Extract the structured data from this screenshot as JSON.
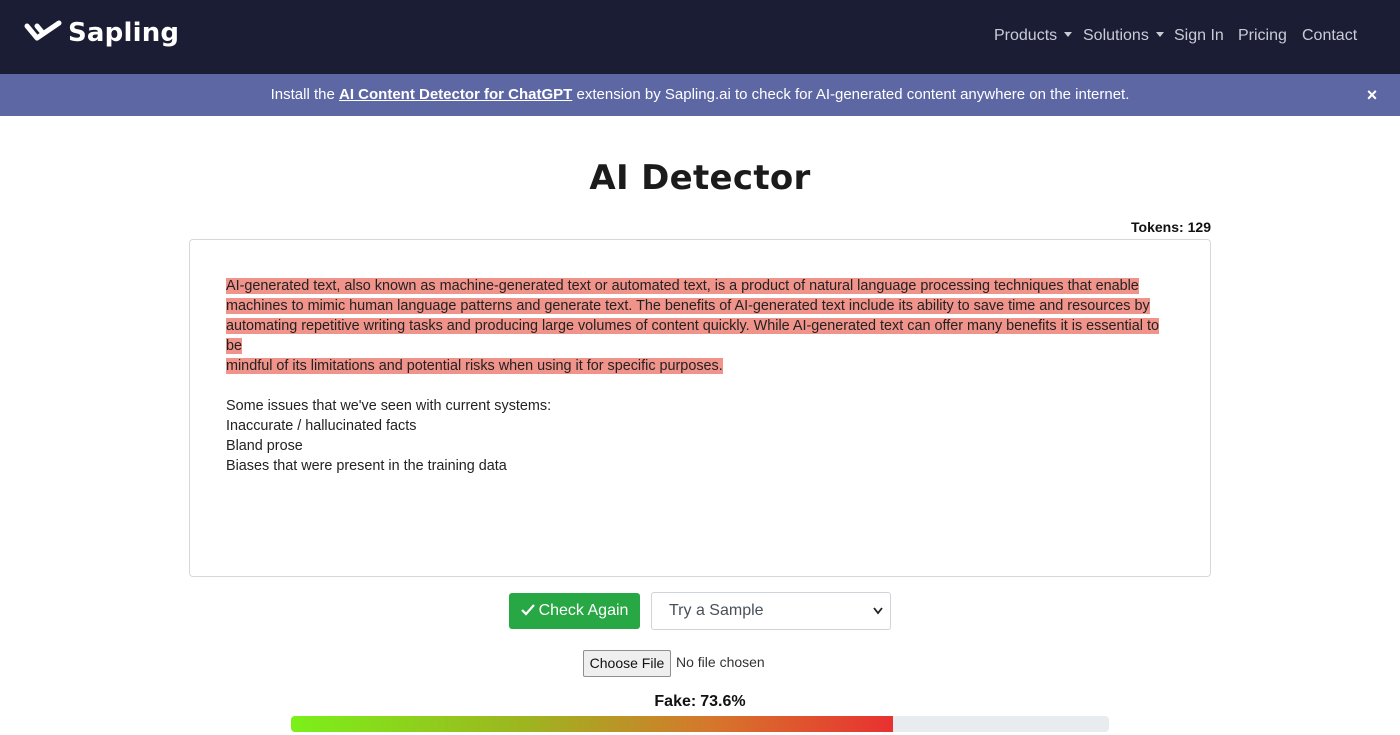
{
  "nav": {
    "brand": "Sapling",
    "items": [
      "Products",
      "Solutions",
      "Sign In",
      "Pricing",
      "Contact"
    ]
  },
  "banner": {
    "prefix": "Install the",
    "link": "AI Content Detector for ChatGPT",
    "suffix": "extension by Sapling.ai to check for AI-generated content anywhere on the internet.",
    "close": "×"
  },
  "page": {
    "title": "AI Detector",
    "tokens_label": "Tokens:",
    "tokens_value": "129"
  },
  "editor": {
    "highlighted_lines": [
      "AI-generated text, also known as machine-generated text or automated text, is a product of natural language processing techniques that enable",
      "machines to mimic human language patterns and generate text. The benefits of AI-generated text include its ability to save time and resources by",
      "automating repetitive writing tasks and producing large volumes of content quickly. While AI-generated text can offer many benefits it is essential to be",
      "mindful of its limitations and potential risks when using it for specific purposes."
    ],
    "plain_lines": [
      "Some issues that we've seen with current systems:",
      "Inaccurate / hallucinated facts",
      "Bland prose",
      "Biases that were present in the training data"
    ]
  },
  "controls": {
    "check_label": "Check Again",
    "sample_select": "Try a Sample",
    "file_button": "Choose File",
    "file_status": "No file chosen"
  },
  "result": {
    "label": "Fake:",
    "value": "73.6%",
    "fake_fraction": 0.736
  },
  "colors": {
    "navbar": "#1b1d35",
    "banner": "#5d67a4",
    "highlight": "#f0938a",
    "check_button": "#28a745"
  }
}
